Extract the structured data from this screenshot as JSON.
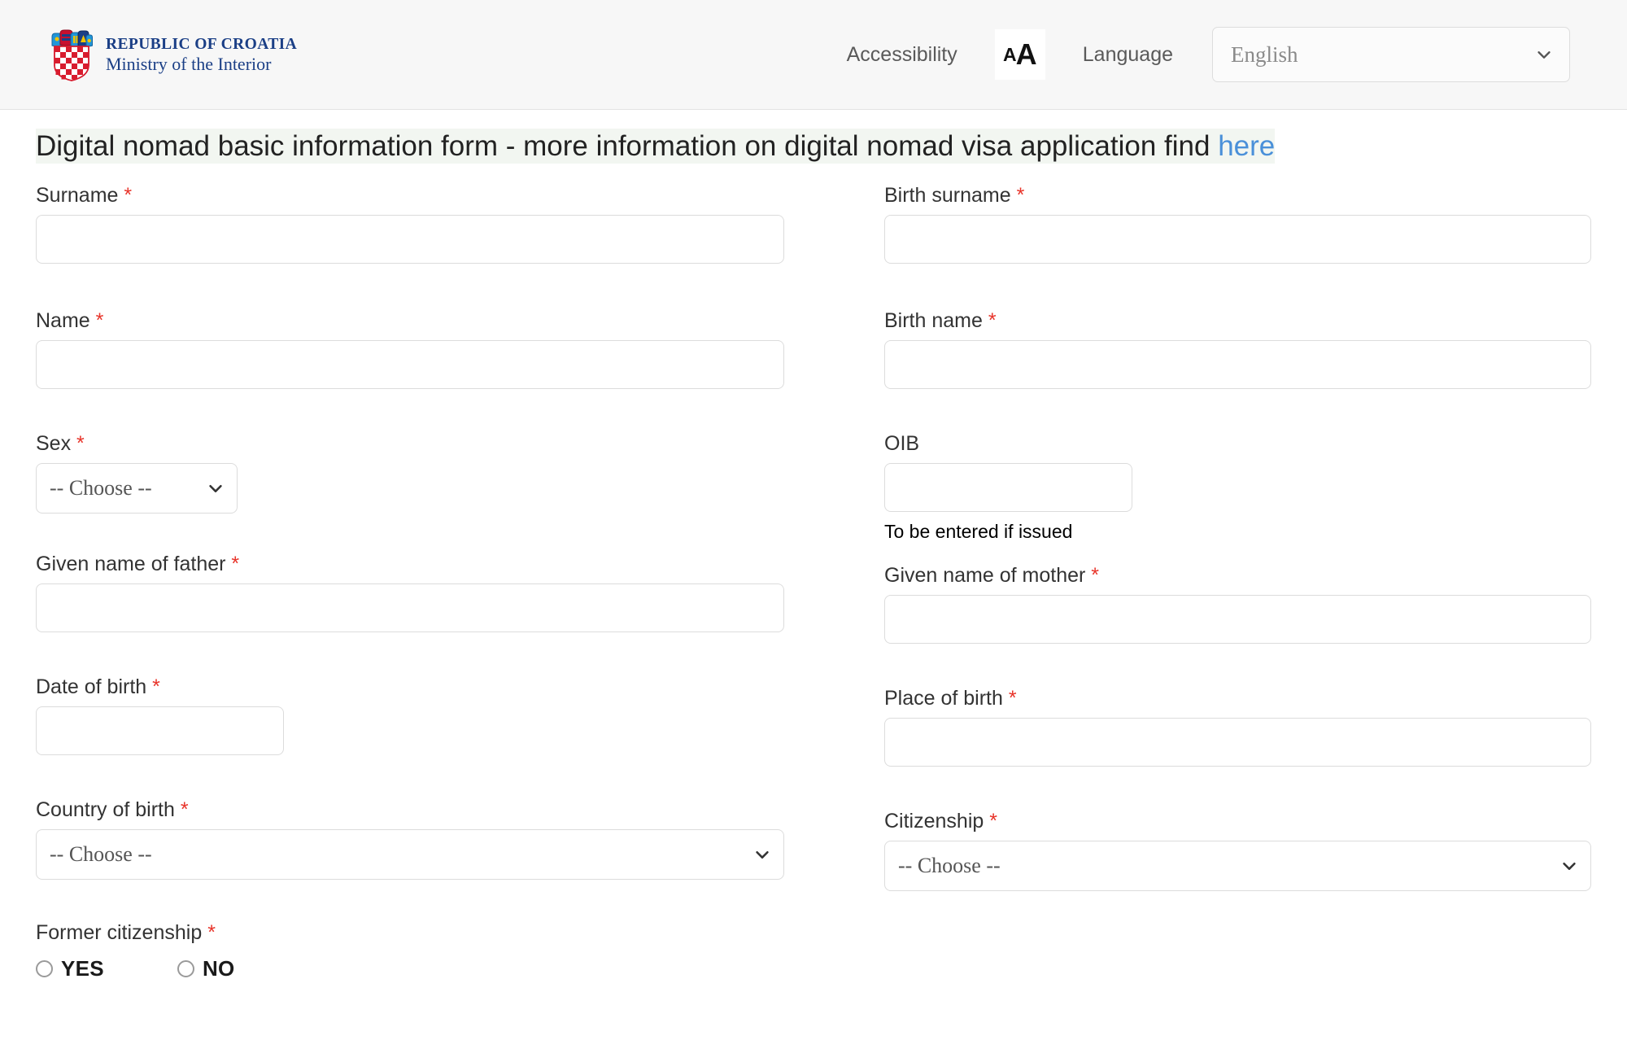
{
  "header": {
    "brand": {
      "line1": "REPUBLIC OF CROATIA",
      "line2": "Ministry of the Interior",
      "logo_icon": "croatian-coat-of-arms-icon"
    },
    "accessibility_label": "Accessibility",
    "font_size_icon": {
      "small": "A",
      "large": "A",
      "icon": "text-size-icon"
    },
    "language_label": "Language",
    "language_select": {
      "value": "English",
      "chevron_icon": "chevron-down-icon"
    }
  },
  "title": {
    "text": "Digital nomad basic information form - more information on digital nomad visa application find ",
    "link_text": "here",
    "highlight_color": "#f2f6f1",
    "link_color": "#4a90d9"
  },
  "form": {
    "required_marker": "*",
    "choose_placeholder": "-- Choose --",
    "fields": {
      "surname": {
        "label": "Surname",
        "value": "",
        "required": true
      },
      "birth_surname": {
        "label": "Birth surname",
        "value": "",
        "required": true
      },
      "name": {
        "label": "Name",
        "value": "",
        "required": true
      },
      "birth_name": {
        "label": "Birth name",
        "value": "",
        "required": true
      },
      "sex": {
        "label": "Sex",
        "value": "-- Choose --",
        "required": true
      },
      "oib": {
        "label": "OIB",
        "value": "",
        "required": false,
        "helper": "To be entered if issued"
      },
      "father_given_name": {
        "label": "Given name of father",
        "value": "",
        "required": true
      },
      "mother_given_name": {
        "label": "Given name of mother",
        "value": "",
        "required": true
      },
      "date_of_birth": {
        "label": "Date of birth",
        "value": "",
        "required": true
      },
      "place_of_birth": {
        "label": "Place of birth",
        "value": "",
        "required": true
      },
      "country_of_birth": {
        "label": "Country of birth",
        "value": "-- Choose --",
        "required": true
      },
      "citizenship": {
        "label": "Citizenship",
        "value": "-- Choose --",
        "required": true
      },
      "former_citizenship": {
        "label": "Former citizenship",
        "required": true,
        "options": [
          {
            "label": "YES",
            "selected": false
          },
          {
            "label": "NO",
            "selected": false
          }
        ]
      }
    }
  },
  "colors": {
    "header_bg": "#f7f7f7",
    "required_red": "#e8342a",
    "brand_blue": "#1b3f86",
    "link_blue": "#4a90d9",
    "input_border": "#dcdcdc"
  }
}
